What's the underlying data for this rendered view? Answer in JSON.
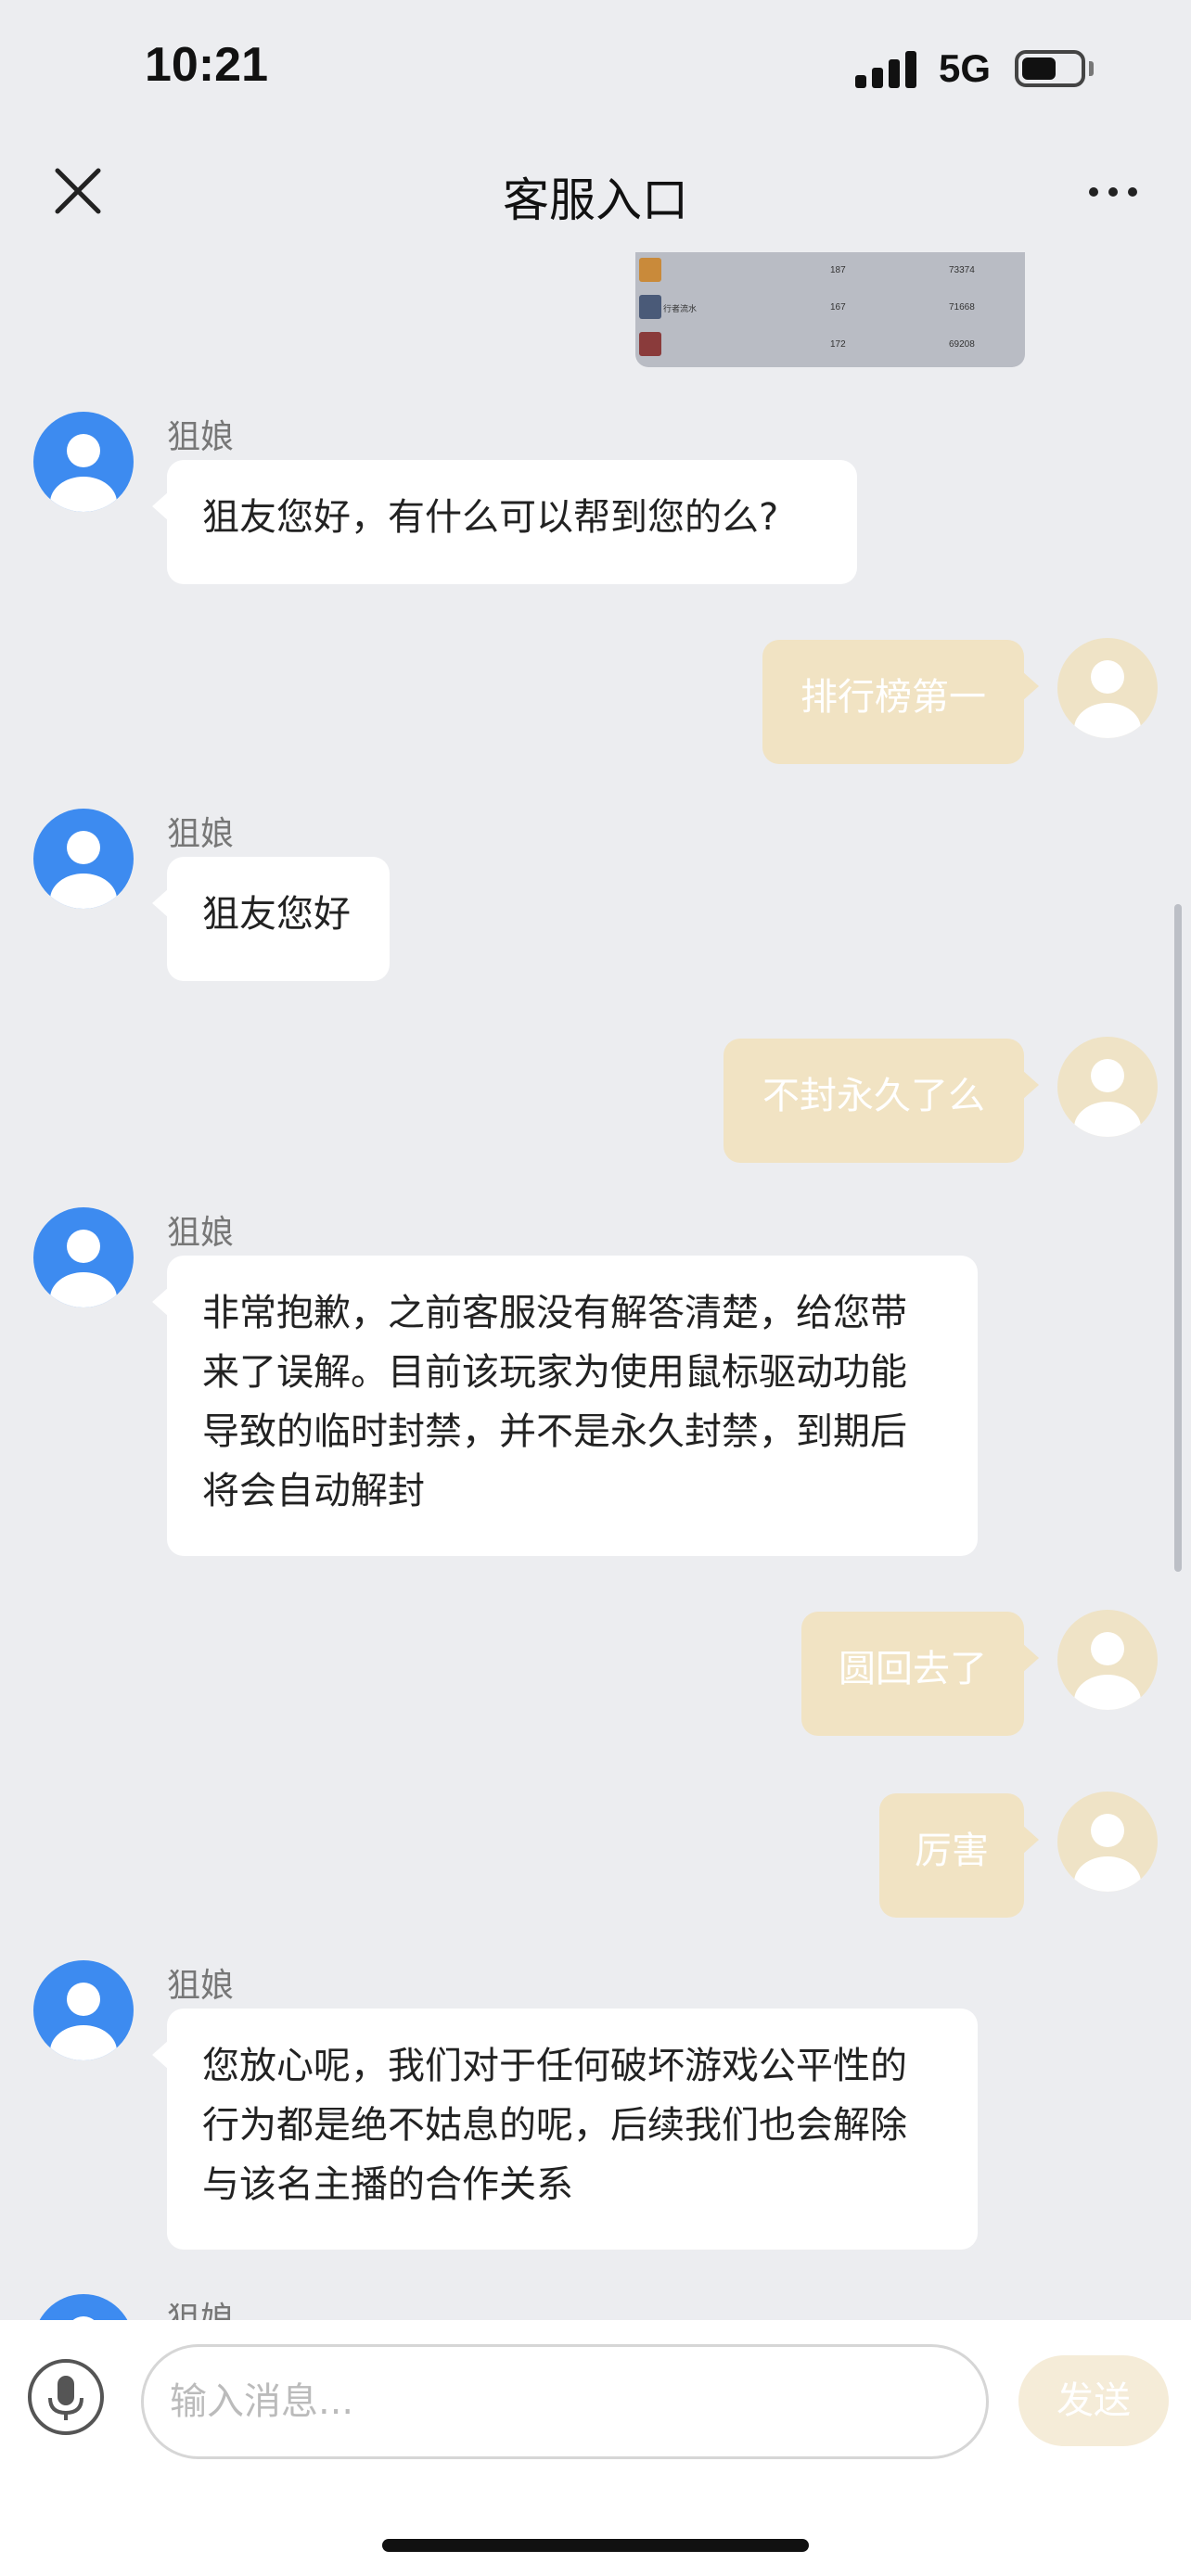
{
  "status": {
    "time": "10:21",
    "network": "5G",
    "icons": [
      "signal-icon",
      "battery-icon"
    ]
  },
  "nav": {
    "title": "客服入口",
    "close_icon": "close-icon",
    "more_icon": "more-icon"
  },
  "preview": {
    "rows": [
      {
        "name": "",
        "count": "187",
        "score": "73374"
      },
      {
        "name": "行者流水",
        "count": "167",
        "score": "71668"
      },
      {
        "name": "",
        "count": "172",
        "score": "69208"
      }
    ]
  },
  "messages": [
    {
      "from": "agent",
      "sender": "狙娘",
      "text": "狙友您好，有什么可以帮到您的么?"
    },
    {
      "from": "me",
      "text": "排行榜第一"
    },
    {
      "from": "agent",
      "sender": "狙娘",
      "text": "狙友您好"
    },
    {
      "from": "me",
      "text": "不封永久了么"
    },
    {
      "from": "agent",
      "sender": "狙娘",
      "lines": [
        "非常抱歉，之前客服没有解答清楚，给您带",
        "来了误解。目前该玩家为使用鼠标驱动功能",
        "导致的临时封禁，并不是永久封禁，到期后",
        "将会自动解封"
      ]
    },
    {
      "from": "me",
      "text": "圆回去了"
    },
    {
      "from": "me",
      "text": "厉害"
    },
    {
      "from": "agent",
      "sender": "狙娘",
      "lines": [
        "您放心呢，我们对于任何破坏游戏公平性的",
        "行为都是绝不姑息的呢，后续我们也会解除",
        "与该名主播的合作关系"
      ]
    },
    {
      "from": "agent",
      "sender": "狙娘",
      "text": ""
    }
  ],
  "composer": {
    "placeholder": "输入消息...",
    "send_label": "发送",
    "mic_icon": "microphone-icon"
  },
  "colors": {
    "agent_avatar": "#3d8bf0",
    "my_bubble": "#f1e3c3",
    "background": "#ecedf0"
  }
}
